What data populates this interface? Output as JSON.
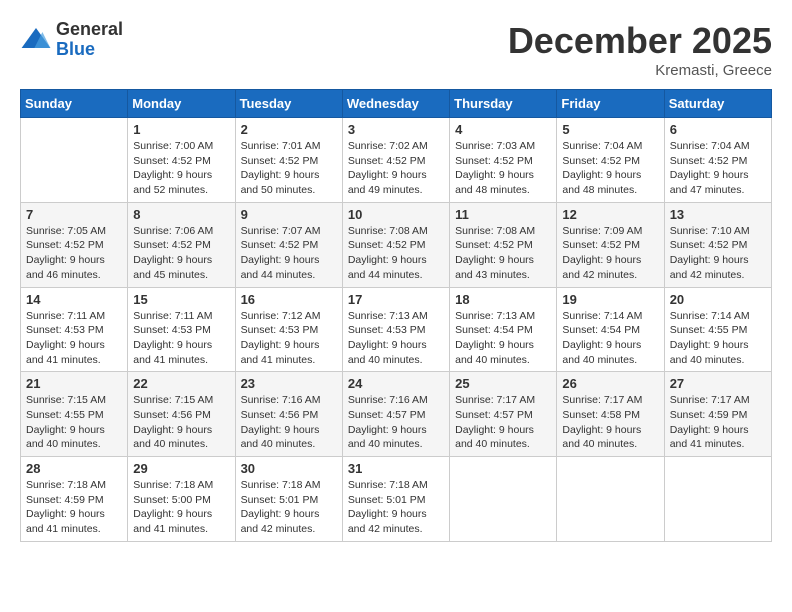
{
  "logo": {
    "general": "General",
    "blue": "Blue"
  },
  "header": {
    "month": "December 2025",
    "location": "Kremasti, Greece"
  },
  "days_of_week": [
    "Sunday",
    "Monday",
    "Tuesday",
    "Wednesday",
    "Thursday",
    "Friday",
    "Saturday"
  ],
  "weeks": [
    [
      {
        "num": "",
        "info": ""
      },
      {
        "num": "1",
        "info": "Sunrise: 7:00 AM\nSunset: 4:52 PM\nDaylight: 9 hours\nand 52 minutes."
      },
      {
        "num": "2",
        "info": "Sunrise: 7:01 AM\nSunset: 4:52 PM\nDaylight: 9 hours\nand 50 minutes."
      },
      {
        "num": "3",
        "info": "Sunrise: 7:02 AM\nSunset: 4:52 PM\nDaylight: 9 hours\nand 49 minutes."
      },
      {
        "num": "4",
        "info": "Sunrise: 7:03 AM\nSunset: 4:52 PM\nDaylight: 9 hours\nand 48 minutes."
      },
      {
        "num": "5",
        "info": "Sunrise: 7:04 AM\nSunset: 4:52 PM\nDaylight: 9 hours\nand 48 minutes."
      },
      {
        "num": "6",
        "info": "Sunrise: 7:04 AM\nSunset: 4:52 PM\nDaylight: 9 hours\nand 47 minutes."
      }
    ],
    [
      {
        "num": "7",
        "info": "Sunrise: 7:05 AM\nSunset: 4:52 PM\nDaylight: 9 hours\nand 46 minutes."
      },
      {
        "num": "8",
        "info": "Sunrise: 7:06 AM\nSunset: 4:52 PM\nDaylight: 9 hours\nand 45 minutes."
      },
      {
        "num": "9",
        "info": "Sunrise: 7:07 AM\nSunset: 4:52 PM\nDaylight: 9 hours\nand 44 minutes."
      },
      {
        "num": "10",
        "info": "Sunrise: 7:08 AM\nSunset: 4:52 PM\nDaylight: 9 hours\nand 44 minutes."
      },
      {
        "num": "11",
        "info": "Sunrise: 7:08 AM\nSunset: 4:52 PM\nDaylight: 9 hours\nand 43 minutes."
      },
      {
        "num": "12",
        "info": "Sunrise: 7:09 AM\nSunset: 4:52 PM\nDaylight: 9 hours\nand 42 minutes."
      },
      {
        "num": "13",
        "info": "Sunrise: 7:10 AM\nSunset: 4:52 PM\nDaylight: 9 hours\nand 42 minutes."
      }
    ],
    [
      {
        "num": "14",
        "info": "Sunrise: 7:11 AM\nSunset: 4:53 PM\nDaylight: 9 hours\nand 41 minutes."
      },
      {
        "num": "15",
        "info": "Sunrise: 7:11 AM\nSunset: 4:53 PM\nDaylight: 9 hours\nand 41 minutes."
      },
      {
        "num": "16",
        "info": "Sunrise: 7:12 AM\nSunset: 4:53 PM\nDaylight: 9 hours\nand 41 minutes."
      },
      {
        "num": "17",
        "info": "Sunrise: 7:13 AM\nSunset: 4:53 PM\nDaylight: 9 hours\nand 40 minutes."
      },
      {
        "num": "18",
        "info": "Sunrise: 7:13 AM\nSunset: 4:54 PM\nDaylight: 9 hours\nand 40 minutes."
      },
      {
        "num": "19",
        "info": "Sunrise: 7:14 AM\nSunset: 4:54 PM\nDaylight: 9 hours\nand 40 minutes."
      },
      {
        "num": "20",
        "info": "Sunrise: 7:14 AM\nSunset: 4:55 PM\nDaylight: 9 hours\nand 40 minutes."
      }
    ],
    [
      {
        "num": "21",
        "info": "Sunrise: 7:15 AM\nSunset: 4:55 PM\nDaylight: 9 hours\nand 40 minutes."
      },
      {
        "num": "22",
        "info": "Sunrise: 7:15 AM\nSunset: 4:56 PM\nDaylight: 9 hours\nand 40 minutes."
      },
      {
        "num": "23",
        "info": "Sunrise: 7:16 AM\nSunset: 4:56 PM\nDaylight: 9 hours\nand 40 minutes."
      },
      {
        "num": "24",
        "info": "Sunrise: 7:16 AM\nSunset: 4:57 PM\nDaylight: 9 hours\nand 40 minutes."
      },
      {
        "num": "25",
        "info": "Sunrise: 7:17 AM\nSunset: 4:57 PM\nDaylight: 9 hours\nand 40 minutes."
      },
      {
        "num": "26",
        "info": "Sunrise: 7:17 AM\nSunset: 4:58 PM\nDaylight: 9 hours\nand 40 minutes."
      },
      {
        "num": "27",
        "info": "Sunrise: 7:17 AM\nSunset: 4:59 PM\nDaylight: 9 hours\nand 41 minutes."
      }
    ],
    [
      {
        "num": "28",
        "info": "Sunrise: 7:18 AM\nSunset: 4:59 PM\nDaylight: 9 hours\nand 41 minutes."
      },
      {
        "num": "29",
        "info": "Sunrise: 7:18 AM\nSunset: 5:00 PM\nDaylight: 9 hours\nand 41 minutes."
      },
      {
        "num": "30",
        "info": "Sunrise: 7:18 AM\nSunset: 5:01 PM\nDaylight: 9 hours\nand 42 minutes."
      },
      {
        "num": "31",
        "info": "Sunrise: 7:18 AM\nSunset: 5:01 PM\nDaylight: 9 hours\nand 42 minutes."
      },
      {
        "num": "",
        "info": ""
      },
      {
        "num": "",
        "info": ""
      },
      {
        "num": "",
        "info": ""
      }
    ]
  ]
}
